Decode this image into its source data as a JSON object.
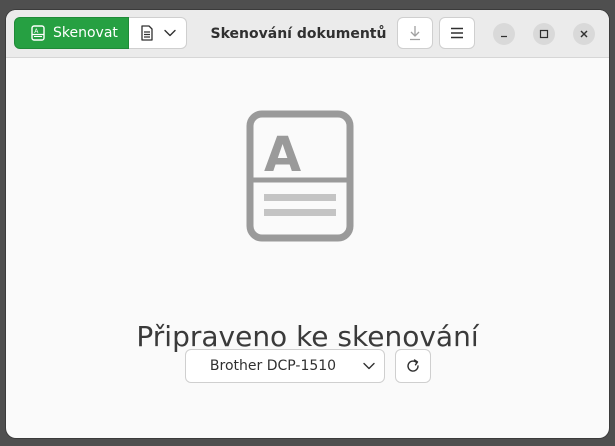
{
  "window": {
    "title": "Skenování dokumentů"
  },
  "toolbar": {
    "scan_label": "Skenovat",
    "scan_icon": "scan-document-icon",
    "document_type_icon": "document-icon",
    "save_icon": "download-icon",
    "menu_icon": "hamburger-menu-icon"
  },
  "window_controls": {
    "minimize_icon": "minimize-icon",
    "maximize_icon": "maximize-icon",
    "close_icon": "close-icon"
  },
  "main": {
    "placeholder_icon": "document-scan-icon",
    "status_text": "Připraveno ke skenování",
    "scanner": {
      "selected": "Brother DCP-1510"
    },
    "refresh_icon": "refresh-icon"
  },
  "colors": {
    "accent": "#26a042",
    "icon_gray": "#9a9a9a"
  }
}
